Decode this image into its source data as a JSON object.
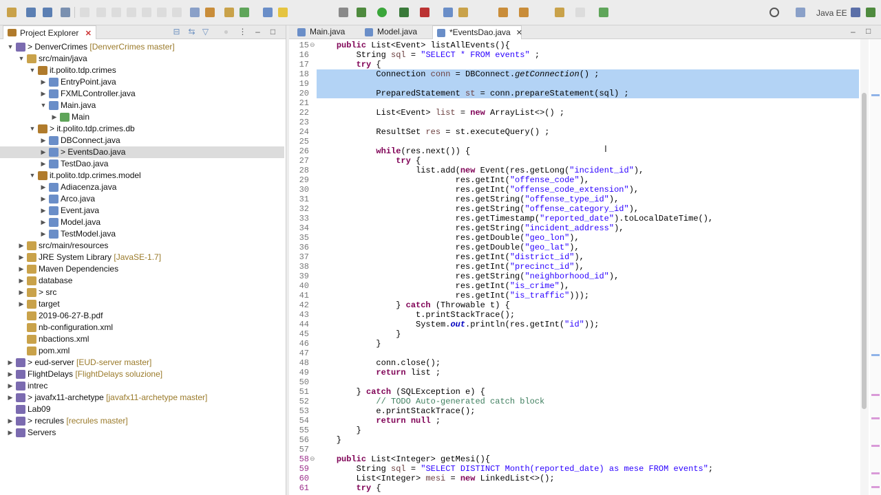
{
  "toolbar": {
    "perspective_label": "Java EE"
  },
  "explorer": {
    "tab_label": "Project Explorer",
    "items": [
      {
        "label": "> DenverCrimes",
        "git": "[DenverCrimes master]",
        "depth": 0,
        "expanded": true
      },
      {
        "label": "src/main/java",
        "depth": 1,
        "expanded": true
      },
      {
        "label": "it.polito.tdp.crimes",
        "depth": 2,
        "expanded": true
      },
      {
        "label": "EntryPoint.java",
        "depth": 3,
        "expanded": false
      },
      {
        "label": "FXMLController.java",
        "depth": 3,
        "expanded": false
      },
      {
        "label": "Main.java",
        "depth": 3,
        "expanded": true
      },
      {
        "label": "Main",
        "depth": 4,
        "expanded": false
      },
      {
        "label": "> it.polito.tdp.crimes.db",
        "depth": 2,
        "expanded": true
      },
      {
        "label": "DBConnect.java",
        "depth": 3,
        "expanded": false
      },
      {
        "label": "> EventsDao.java",
        "depth": 3,
        "expanded": false,
        "selected": true
      },
      {
        "label": "TestDao.java",
        "depth": 3,
        "expanded": false
      },
      {
        "label": "it.polito.tdp.crimes.model",
        "depth": 2,
        "expanded": true
      },
      {
        "label": "Adiacenza.java",
        "depth": 3,
        "expanded": false
      },
      {
        "label": "Arco.java",
        "depth": 3,
        "expanded": false
      },
      {
        "label": "Event.java",
        "depth": 3,
        "expanded": false
      },
      {
        "label": "Model.java",
        "depth": 3,
        "expanded": false
      },
      {
        "label": "TestModel.java",
        "depth": 3,
        "expanded": false
      },
      {
        "label": "src/main/resources",
        "depth": 1,
        "expanded": false
      },
      {
        "label": "JRE System Library",
        "git": "[JavaSE-1.7]",
        "depth": 1,
        "expanded": false
      },
      {
        "label": "Maven Dependencies",
        "depth": 1,
        "expanded": false
      },
      {
        "label": "database",
        "depth": 1,
        "expanded": false
      },
      {
        "label": "> src",
        "depth": 1,
        "expanded": false
      },
      {
        "label": "target",
        "depth": 1,
        "expanded": false
      },
      {
        "label": "2019-06-27-B.pdf",
        "depth": 1,
        "noarrow": true
      },
      {
        "label": "nb-configuration.xml",
        "depth": 1,
        "noarrow": true
      },
      {
        "label": "nbactions.xml",
        "depth": 1,
        "noarrow": true
      },
      {
        "label": "pom.xml",
        "depth": 1,
        "noarrow": true
      },
      {
        "label": "> eud-server",
        "git": "[EUD-server master]",
        "depth": 0,
        "expanded": false
      },
      {
        "label": "FlightDelays",
        "git": "[FlightDelays soluzione]",
        "depth": 0,
        "expanded": false
      },
      {
        "label": "intrec",
        "depth": 0,
        "expanded": false
      },
      {
        "label": "> javafx11-archetype",
        "git": "[javafx11-archetype master]",
        "depth": 0,
        "expanded": false
      },
      {
        "label": "Lab09",
        "depth": 0,
        "noarrow": true
      },
      {
        "label": "> recrules",
        "git": "[recrules master]",
        "depth": 0,
        "expanded": false
      },
      {
        "label": "Servers",
        "depth": 0,
        "expanded": false
      }
    ]
  },
  "editor": {
    "tabs": [
      {
        "label": "Main.java",
        "active": false
      },
      {
        "label": "Model.java",
        "active": false
      },
      {
        "label": "*EventsDao.java",
        "active": true
      }
    ],
    "lines": [
      {
        "n": "15",
        "text": "    public List<Event> listAllEvents(){"
      },
      {
        "n": "16",
        "text": "        String sql = \"SELECT * FROM events\" ;"
      },
      {
        "n": "17",
        "text": "        try {"
      },
      {
        "n": "18",
        "text": "            Connection conn = DBConnect.getConnection() ;",
        "sel": true
      },
      {
        "n": "19",
        "text": "",
        "sel": true
      },
      {
        "n": "20",
        "text": "            PreparedStatement st = conn.prepareStatement(sql) ;",
        "sel": true
      },
      {
        "n": "21",
        "text": ""
      },
      {
        "n": "22",
        "text": "            List<Event> list = new ArrayList<>() ;"
      },
      {
        "n": "23",
        "text": ""
      },
      {
        "n": "24",
        "text": "            ResultSet res = st.executeQuery() ;"
      },
      {
        "n": "25",
        "text": ""
      },
      {
        "n": "26",
        "text": "            while(res.next()) {"
      },
      {
        "n": "27",
        "text": "                try {"
      },
      {
        "n": "28",
        "text": "                    list.add(new Event(res.getLong(\"incident_id\"),"
      },
      {
        "n": "29",
        "text": "                            res.getInt(\"offense_code\"),"
      },
      {
        "n": "30",
        "text": "                            res.getInt(\"offense_code_extension\"),"
      },
      {
        "n": "31",
        "text": "                            res.getString(\"offense_type_id\"),"
      },
      {
        "n": "32",
        "text": "                            res.getString(\"offense_category_id\"),"
      },
      {
        "n": "33",
        "text": "                            res.getTimestamp(\"reported_date\").toLocalDateTime(),"
      },
      {
        "n": "34",
        "text": "                            res.getString(\"incident_address\"),"
      },
      {
        "n": "35",
        "text": "                            res.getDouble(\"geo_lon\"),"
      },
      {
        "n": "36",
        "text": "                            res.getDouble(\"geo_lat\"),"
      },
      {
        "n": "37",
        "text": "                            res.getInt(\"district_id\"),"
      },
      {
        "n": "38",
        "text": "                            res.getInt(\"precinct_id\"),"
      },
      {
        "n": "39",
        "text": "                            res.getString(\"neighborhood_id\"),"
      },
      {
        "n": "40",
        "text": "                            res.getInt(\"is_crime\"),"
      },
      {
        "n": "41",
        "text": "                            res.getInt(\"is_traffic\")));"
      },
      {
        "n": "42",
        "text": "                } catch (Throwable t) {"
      },
      {
        "n": "43",
        "text": "                    t.printStackTrace();"
      },
      {
        "n": "44",
        "text": "                    System.out.println(res.getInt(\"id\"));"
      },
      {
        "n": "45",
        "text": "                }"
      },
      {
        "n": "46",
        "text": "            }"
      },
      {
        "n": "47",
        "text": ""
      },
      {
        "n": "48",
        "text": "            conn.close();"
      },
      {
        "n": "49",
        "text": "            return list ;"
      },
      {
        "n": "50",
        "text": ""
      },
      {
        "n": "51",
        "text": "        } catch (SQLException e) {"
      },
      {
        "n": "52",
        "text": "            // TODO Auto-generated catch block"
      },
      {
        "n": "53",
        "text": "            e.printStackTrace();"
      },
      {
        "n": "54",
        "text": "            return null ;"
      },
      {
        "n": "55",
        "text": "        }"
      },
      {
        "n": "56",
        "text": "    }"
      },
      {
        "n": "57",
        "text": ""
      },
      {
        "n": "58",
        "text": "    public List<Integer> getMesi(){"
      },
      {
        "n": "59",
        "text": "        String sql = \"SELECT DISTINCT Month(reported_date) as mese FROM events\";"
      },
      {
        "n": "60",
        "text": "        List<Integer> mesi = new LinkedList<>();"
      },
      {
        "n": "61",
        "text": "        try {"
      }
    ]
  }
}
